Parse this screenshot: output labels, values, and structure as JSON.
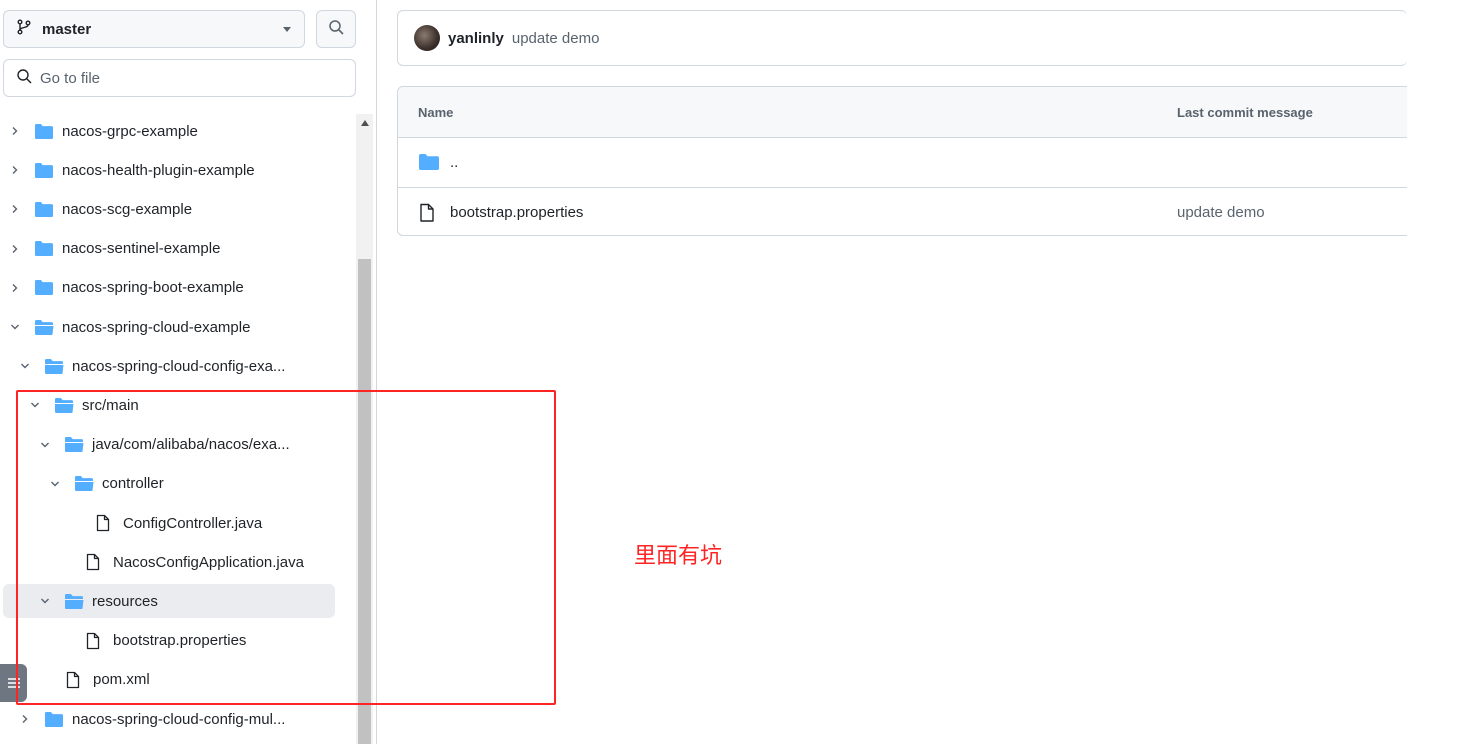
{
  "sidebar": {
    "branch": "master",
    "goto_placeholder": "Go to file",
    "tree": [
      {
        "label": "nacos-grpc-example",
        "type": "folder",
        "expanded": false,
        "indent": 0
      },
      {
        "label": "nacos-health-plugin-example",
        "type": "folder",
        "expanded": false,
        "indent": 0
      },
      {
        "label": "nacos-scg-example",
        "type": "folder",
        "expanded": false,
        "indent": 0
      },
      {
        "label": "nacos-sentinel-example",
        "type": "folder",
        "expanded": false,
        "indent": 0
      },
      {
        "label": "nacos-spring-boot-example",
        "type": "folder",
        "expanded": false,
        "indent": 0
      },
      {
        "label": "nacos-spring-cloud-example",
        "type": "folder",
        "expanded": true,
        "indent": 0
      },
      {
        "label": "nacos-spring-cloud-config-exa...",
        "type": "folder",
        "expanded": true,
        "indent": 1
      },
      {
        "label": "src/main",
        "type": "folder",
        "expanded": true,
        "indent": 2
      },
      {
        "label": "java/com/alibaba/nacos/exa...",
        "type": "folder",
        "expanded": true,
        "indent": 3
      },
      {
        "label": "controller",
        "type": "folder",
        "expanded": true,
        "indent": 4
      },
      {
        "label": "ConfigController.java",
        "type": "file",
        "indent": 5
      },
      {
        "label": "NacosConfigApplication.java",
        "type": "file",
        "indent": 4
      },
      {
        "label": "resources",
        "type": "folder",
        "expanded": true,
        "indent": 3,
        "selected": true
      },
      {
        "label": "bootstrap.properties",
        "type": "file",
        "indent": 4
      },
      {
        "label": "pom.xml",
        "type": "file",
        "indent": 2
      },
      {
        "label": "nacos-spring-cloud-config-mul...",
        "type": "folder",
        "expanded": false,
        "indent": 1
      }
    ]
  },
  "commit": {
    "author": "yanlinly",
    "message": "update demo"
  },
  "files": {
    "headers": {
      "name": "Name",
      "last_commit": "Last commit message"
    },
    "rows": [
      {
        "name": "..",
        "type": "folder",
        "message": ""
      },
      {
        "name": "bootstrap.properties",
        "type": "file",
        "message": "update demo"
      }
    ]
  },
  "annotation": {
    "text": "里面有坑",
    "color": "#ff2424"
  },
  "colors": {
    "folder": "#54aeff",
    "border": "#d0d7de",
    "muted": "#59636e"
  }
}
